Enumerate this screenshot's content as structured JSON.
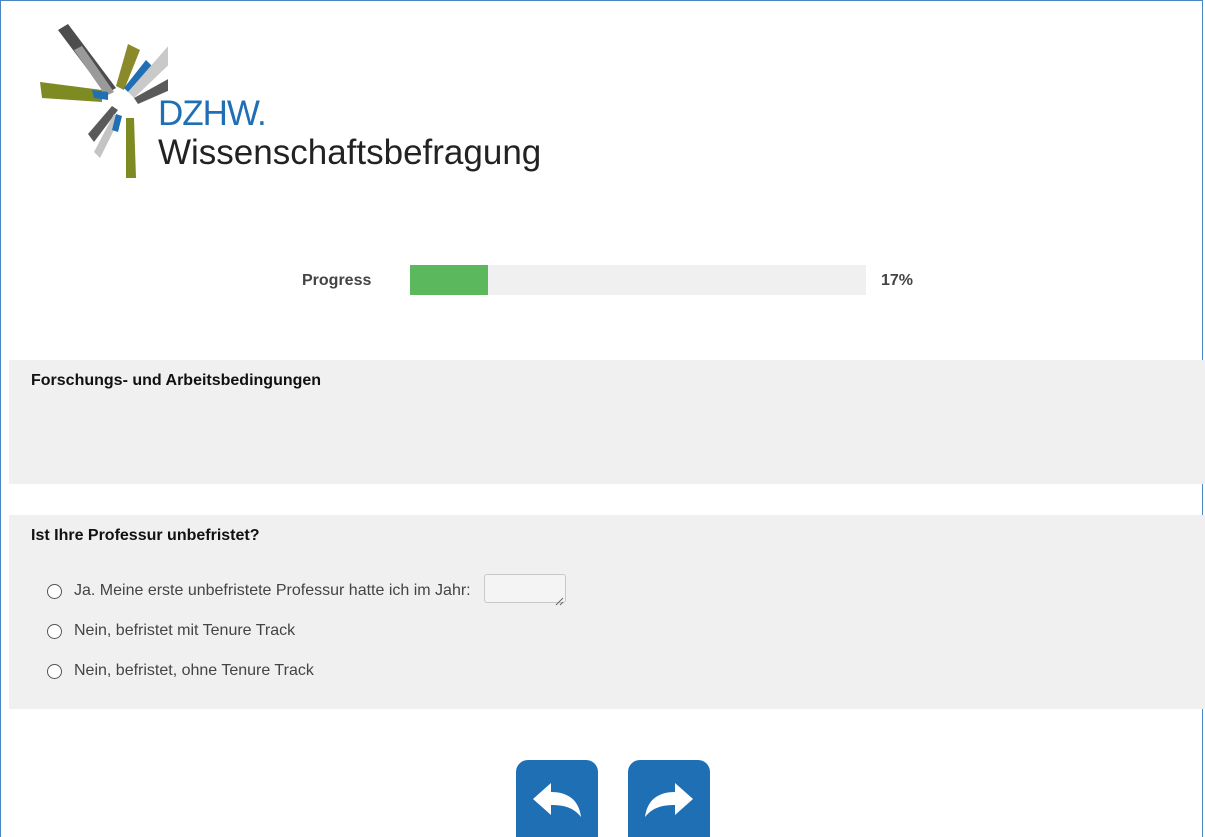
{
  "logo": {
    "brand": "DZHW.",
    "subtitle": "Wissenschaftsbefragung"
  },
  "progress": {
    "label": "Progress",
    "value_text": "17%",
    "fraction": 0.17,
    "fill_color": "#5cb85c"
  },
  "section": {
    "title": "Forschungs- und Arbeitsbedingungen"
  },
  "question": {
    "title": "Ist Ihre Professur unbefristet?",
    "options": [
      {
        "label": "Ja. Meine erste unbefristete Professur hatte ich im Jahr:",
        "selected": false,
        "has_input": true,
        "input_value": ""
      },
      {
        "label": "Nein, befristet mit Tenure Track",
        "selected": false
      },
      {
        "label": "Nein, befristet, ohne Tenure Track",
        "selected": false
      }
    ]
  },
  "navigation": {
    "back_icon": "arrow-back-icon",
    "next_icon": "arrow-forward-icon",
    "button_color": "#1f6fb5"
  },
  "colors": {
    "accent": "#1f6fb5",
    "panel_bg": "#f0f0f0",
    "frame_border": "#4a86c5"
  }
}
